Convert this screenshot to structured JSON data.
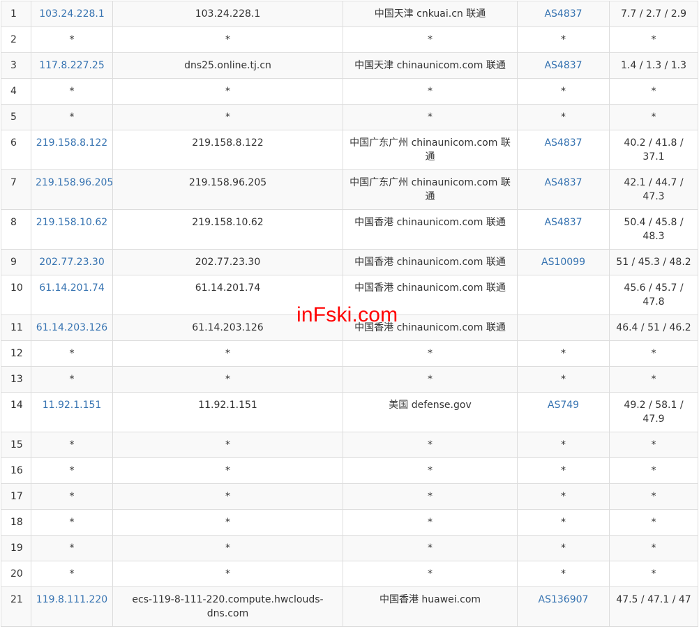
{
  "watermark": "inFski.com",
  "rows": [
    {
      "hop": "1",
      "ip": "103.24.228.1",
      "host": "103.24.228.1",
      "location": "中国天津 cnkuai.cn 联通",
      "asn": "AS4837",
      "rtt": "7.7 / 2.7 / 2.9"
    },
    {
      "hop": "2",
      "ip": "*",
      "host": "*",
      "location": "*",
      "asn": "*",
      "rtt": "*"
    },
    {
      "hop": "3",
      "ip": "117.8.227.25",
      "host": "dns25.online.tj.cn",
      "location": "中国天津 chinaunicom.com 联通",
      "asn": "AS4837",
      "rtt": "1.4 / 1.3 / 1.3"
    },
    {
      "hop": "4",
      "ip": "*",
      "host": "*",
      "location": "*",
      "asn": "*",
      "rtt": "*"
    },
    {
      "hop": "5",
      "ip": "*",
      "host": "*",
      "location": "*",
      "asn": "*",
      "rtt": "*"
    },
    {
      "hop": "6",
      "ip": "219.158.8.122",
      "host": "219.158.8.122",
      "location": "中国广东广州 chinaunicom.com 联通",
      "asn": "AS4837",
      "rtt": "40.2 / 41.8 / 37.1"
    },
    {
      "hop": "7",
      "ip": "219.158.96.205",
      "host": "219.158.96.205",
      "location": "中国广东广州 chinaunicom.com 联通",
      "asn": "AS4837",
      "rtt": "42.1 / 44.7 / 47.3"
    },
    {
      "hop": "8",
      "ip": "219.158.10.62",
      "host": "219.158.10.62",
      "location": "中国香港 chinaunicom.com 联通",
      "asn": "AS4837",
      "rtt": "50.4 / 45.8 / 48.3"
    },
    {
      "hop": "9",
      "ip": "202.77.23.30",
      "host": "202.77.23.30",
      "location": "中国香港 chinaunicom.com 联通",
      "asn": "AS10099",
      "rtt": "51 / 45.3 / 48.2"
    },
    {
      "hop": "10",
      "ip": "61.14.201.74",
      "host": "61.14.201.74",
      "location": "中国香港 chinaunicom.com 联通",
      "asn": "",
      "rtt": "45.6 / 45.7 / 47.8"
    },
    {
      "hop": "11",
      "ip": "61.14.203.126",
      "host": "61.14.203.126",
      "location": "中国香港 chinaunicom.com 联通",
      "asn": "",
      "rtt": "46.4 / 51 / 46.2"
    },
    {
      "hop": "12",
      "ip": "*",
      "host": "*",
      "location": "*",
      "asn": "*",
      "rtt": "*"
    },
    {
      "hop": "13",
      "ip": "*",
      "host": "*",
      "location": "*",
      "asn": "*",
      "rtt": "*"
    },
    {
      "hop": "14",
      "ip": "11.92.1.151",
      "host": "11.92.1.151",
      "location": "美国 defense.gov",
      "asn": "AS749",
      "rtt": "49.2 / 58.1 / 47.9"
    },
    {
      "hop": "15",
      "ip": "*",
      "host": "*",
      "location": "*",
      "asn": "*",
      "rtt": "*"
    },
    {
      "hop": "16",
      "ip": "*",
      "host": "*",
      "location": "*",
      "asn": "*",
      "rtt": "*"
    },
    {
      "hop": "17",
      "ip": "*",
      "host": "*",
      "location": "*",
      "asn": "*",
      "rtt": "*"
    },
    {
      "hop": "18",
      "ip": "*",
      "host": "*",
      "location": "*",
      "asn": "*",
      "rtt": "*"
    },
    {
      "hop": "19",
      "ip": "*",
      "host": "*",
      "location": "*",
      "asn": "*",
      "rtt": "*"
    },
    {
      "hop": "20",
      "ip": "*",
      "host": "*",
      "location": "*",
      "asn": "*",
      "rtt": "*"
    },
    {
      "hop": "21",
      "ip": "119.8.111.220",
      "host": "ecs-119-8-111-220.compute.hwclouds-dns.com",
      "location": "中国香港 huawei.com",
      "asn": "AS136907",
      "rtt": "47.5 / 47.1 / 47"
    }
  ]
}
